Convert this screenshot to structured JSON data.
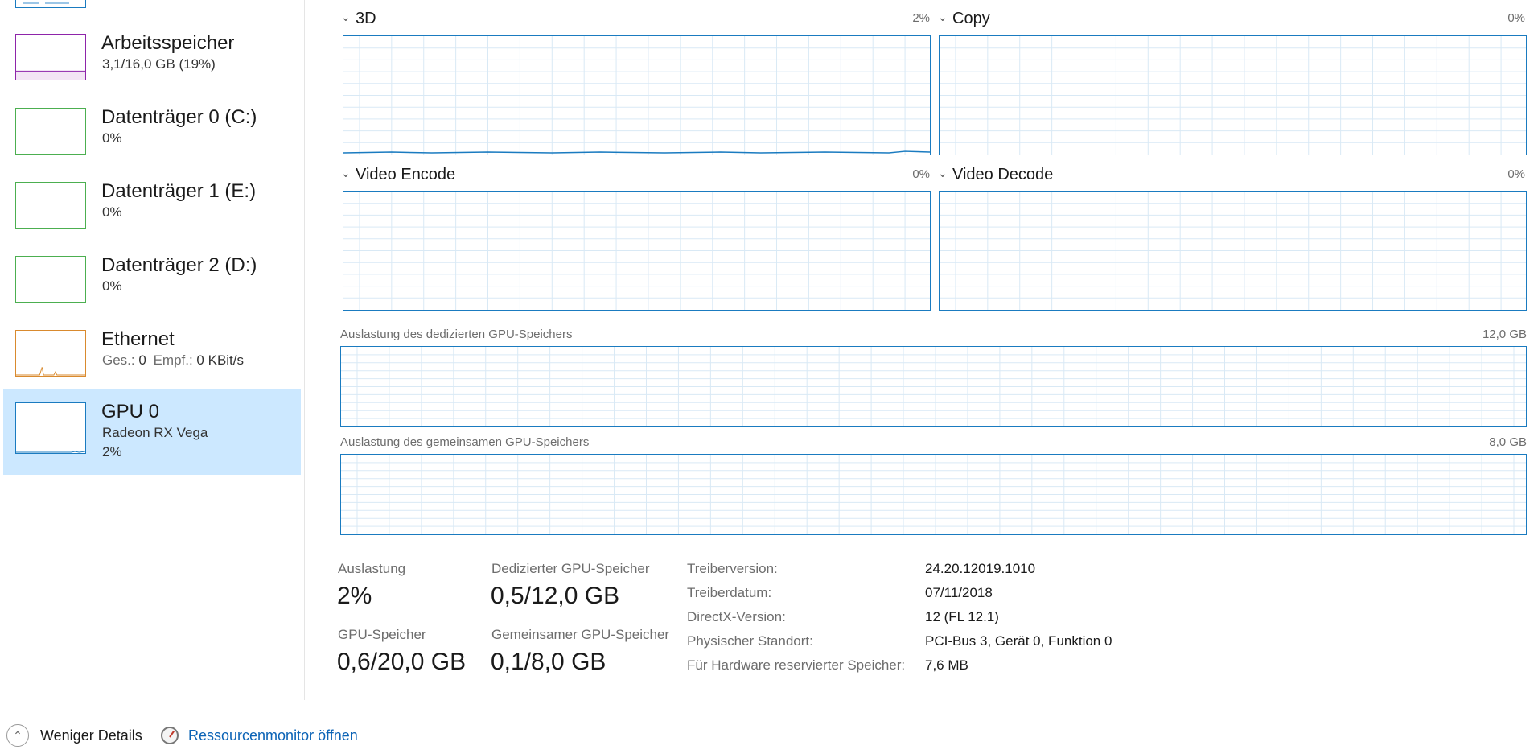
{
  "sidebar": {
    "items": [
      {
        "title": "Arbeitsspeicher",
        "sub": "3,1/16,0 GB (19%)",
        "color": "#8e24aa"
      },
      {
        "title": "Datenträger 0 (C:)",
        "sub": "0%",
        "color": "#4caf50"
      },
      {
        "title": "Datenträger 1 (E:)",
        "sub": "0%",
        "color": "#4caf50"
      },
      {
        "title": "Datenträger 2 (D:)",
        "sub": "0%",
        "color": "#4caf50"
      },
      {
        "title": "Ethernet",
        "send_label": "Ges.:",
        "send_value": "0",
        "recv_label": "Empf.:",
        "recv_value": "0 KBit/s",
        "color": "#d98a2e"
      },
      {
        "title": "GPU 0",
        "sub": "Radeon RX Vega",
        "sub2": "2%",
        "color": "#1a7bc0",
        "selected": true
      }
    ]
  },
  "engines": [
    {
      "name": "3D",
      "pct": "2%"
    },
    {
      "name": "Copy",
      "pct": "0%"
    },
    {
      "name": "Video Encode",
      "pct": "0%"
    },
    {
      "name": "Video Decode",
      "pct": "0%"
    }
  ],
  "memory_graphs": {
    "dedicated": {
      "label": "Auslastung des dedizierten GPU-Speichers",
      "max": "12,0 GB"
    },
    "shared": {
      "label": "Auslastung des gemeinsamen GPU-Speichers",
      "max": "8,0 GB"
    }
  },
  "stats": {
    "utilization": {
      "label": "Auslastung",
      "value": "2%"
    },
    "dedicated": {
      "label": "Dedizierter GPU-Speicher",
      "value": "0,5/12,0 GB"
    },
    "gpu_memory": {
      "label": "GPU-Speicher",
      "value": "0,6/20,0 GB"
    },
    "shared": {
      "label": "Gemeinsamer GPU-Speicher",
      "value": "0,1/8,0 GB"
    }
  },
  "info": [
    {
      "key": "Treiberversion:",
      "value": "24.20.12019.1010"
    },
    {
      "key": "Treiberdatum:",
      "value": "07/11/2018"
    },
    {
      "key": "DirectX-Version:",
      "value": "12 (FL 12.1)"
    },
    {
      "key": "Physischer Standort:",
      "value": "PCI-Bus 3, Gerät 0, Funktion 0"
    },
    {
      "key": "Für Hardware reservierter Speicher:",
      "value": "7,6 MB"
    }
  ],
  "footer": {
    "less_details": "Weniger Details",
    "resource_monitor": "Ressourcenmonitor öffnen"
  },
  "colors": {
    "accent": "#1a7bc0",
    "selected_bg": "#cce8ff",
    "grid": "#d9e9f5"
  },
  "icons": {
    "collapse": "chevron-down-icon",
    "less": "chevron-up-circle-icon",
    "resmon": "resource-monitor-icon"
  }
}
